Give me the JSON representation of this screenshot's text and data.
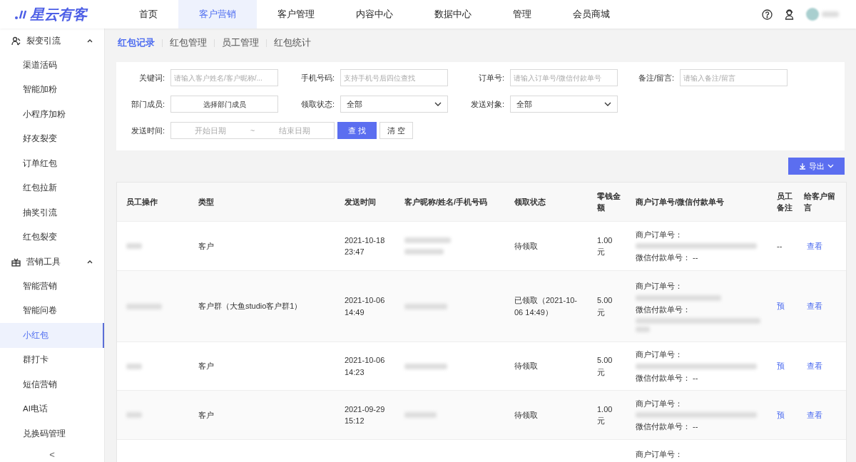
{
  "brand": {
    "name": "星云有客"
  },
  "top_nav": [
    {
      "label": "首页",
      "selected": false
    },
    {
      "label": "客户营销",
      "selected": true
    },
    {
      "label": "客户管理",
      "selected": false
    },
    {
      "label": "内容中心",
      "selected": false
    },
    {
      "label": "数据中心",
      "selected": false
    },
    {
      "label": "管理",
      "selected": false
    },
    {
      "label": "会员商城",
      "selected": false
    }
  ],
  "sidebar": {
    "groups": [
      {
        "label": "裂变引流",
        "expanded": true,
        "items": [
          {
            "label": "渠道活码",
            "selected": false
          },
          {
            "label": "智能加粉",
            "selected": false
          },
          {
            "label": "小程序加粉",
            "selected": false
          },
          {
            "label": "好友裂变",
            "selected": false
          },
          {
            "label": "订单红包",
            "selected": false
          },
          {
            "label": "红包拉新",
            "selected": false
          },
          {
            "label": "抽奖引流",
            "selected": false
          },
          {
            "label": "红包裂变",
            "selected": false
          }
        ]
      },
      {
        "label": "营销工具",
        "expanded": true,
        "items": [
          {
            "label": "智能营销",
            "selected": false
          },
          {
            "label": "智能问卷",
            "selected": false
          },
          {
            "label": "小红包",
            "selected": true
          },
          {
            "label": "群打卡",
            "selected": false
          },
          {
            "label": "短信营销",
            "selected": false
          },
          {
            "label": "AI电话",
            "selected": false
          },
          {
            "label": "兑换码管理",
            "selected": false
          }
        ]
      }
    ],
    "collapse": "<"
  },
  "sub_tabs": [
    {
      "label": "红包记录",
      "selected": true
    },
    {
      "label": "红包管理",
      "selected": false
    },
    {
      "label": "员工管理",
      "selected": false
    },
    {
      "label": "红包统计",
      "selected": false
    }
  ],
  "filters": [
    {
      "kind": "input",
      "label": "关键词:",
      "placeholder": "请输入客户姓名/客户昵称/..."
    },
    {
      "kind": "input",
      "label": "手机号码:",
      "placeholder": "支持手机号后四位查找"
    },
    {
      "kind": "input",
      "label": "订单号:",
      "placeholder": "请输入订单号/微信付款单号"
    },
    {
      "kind": "input",
      "label": "备注/留言:",
      "placeholder": "请输入备注/留言"
    },
    {
      "kind": "picker",
      "label": "部门成员:",
      "value": "选择部门成员"
    },
    {
      "kind": "select",
      "label": "领取状态:",
      "value": "全部"
    },
    {
      "kind": "select",
      "label": "发送对象:",
      "value": "全部"
    }
  ],
  "date_filter": {
    "label": "发送时间:",
    "start_placeholder": "开始日期",
    "separator": "~",
    "end_placeholder": "结束日期"
  },
  "search_button": "查 找",
  "clear_button": "清 空",
  "export_button": "导出",
  "table": {
    "columns": [
      "员工操作",
      "类型",
      "发送时间",
      "客户昵称/姓名/手机号码",
      "领取状态",
      "零钱金额",
      "商户订单号/微信付款单号",
      "员工备注",
      "给客户留言"
    ],
    "rows": [
      {
        "type": "客户",
        "time": "2021-10-18 23:47",
        "status": "待领取",
        "amount": "1.00 元",
        "merchant_label": "商户订单号：",
        "wechat_label": "微信付款单号：",
        "wechat_no": "--",
        "note": {
          "kind": "text",
          "text": "--"
        },
        "message": "查看"
      },
      {
        "type": "客户群（大鱼studio客户群1）",
        "time": "2021-10-06 14:49",
        "status": "已领取（2021-10-06 14:49）",
        "amount": "5.00 元",
        "merchant_label": "商户订单号：",
        "wechat_label": "微信付款单号：",
        "note": {
          "kind": "link",
          "text": "预"
        },
        "message": "查看"
      },
      {
        "type": "客户",
        "time": "2021-10-06 14:23",
        "status": "待领取",
        "amount": "5.00 元",
        "merchant_label": "商户订单号：",
        "wechat_label": "微信付款单号：",
        "wechat_no": "--",
        "note": {
          "kind": "link",
          "text": "预"
        },
        "message": "查看"
      },
      {
        "type": "客户",
        "time": "2021-09-29 15:12",
        "status": "待领取",
        "amount": "1.00 元",
        "merchant_label": "商户订单号：",
        "wechat_label": "微信付款单号：",
        "wechat_no": "--",
        "note": {
          "kind": "link",
          "text": "预"
        },
        "message": "查看"
      },
      {
        "merchant_label": "商户订单号："
      }
    ]
  }
}
